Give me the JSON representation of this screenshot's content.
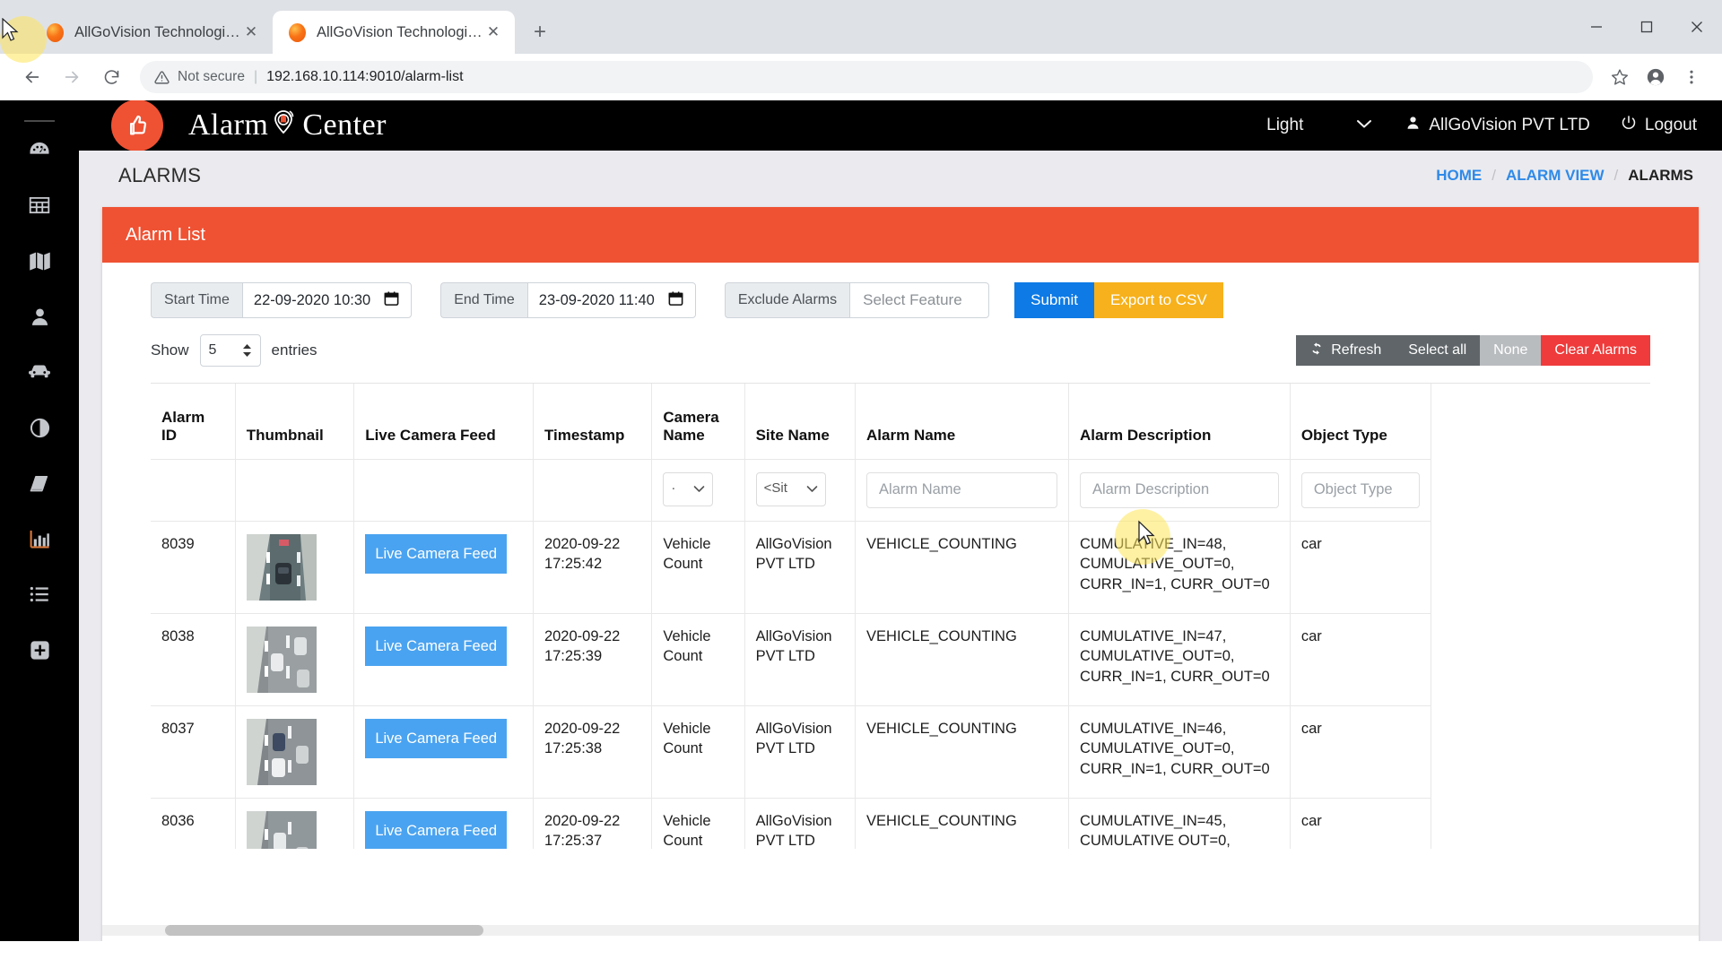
{
  "browser": {
    "tabs": [
      {
        "title": "AllGoVision Technologies",
        "active": false
      },
      {
        "title": "AllGoVision Technologies",
        "active": true
      }
    ],
    "newtab_label": "+",
    "close_label": "✕",
    "window_controls": {
      "minimize": "–",
      "maximize": "❐",
      "close": "✕"
    },
    "address": {
      "security_label": "Not secure",
      "separator": "|",
      "url": "192.168.10.114:9010/alarm-list"
    }
  },
  "sidebar": {
    "items": [
      {
        "icon": "dashboard-gauge-icon",
        "label": "Dashboard"
      },
      {
        "icon": "table-grid-icon",
        "label": "Table"
      },
      {
        "icon": "map-icon",
        "label": "Map"
      },
      {
        "icon": "person-icon",
        "label": "People"
      },
      {
        "icon": "car-icon",
        "label": "Vehicles"
      },
      {
        "icon": "contrast-circle-icon",
        "label": "Contrast"
      },
      {
        "icon": "book-icon",
        "label": "Reports"
      },
      {
        "icon": "bar-chart-icon",
        "label": "Analytics"
      },
      {
        "icon": "list-icon",
        "label": "Alarm List"
      },
      {
        "icon": "plus-square-icon",
        "label": "Add"
      }
    ]
  },
  "appheader": {
    "logo_icon": "thumbs-up-icon",
    "brand_first": "Alarm",
    "brand_icon": "alarm-pin-icon",
    "brand_second": "Center",
    "theme": {
      "value": "Light",
      "chevron": "⌄"
    },
    "user": {
      "icon": "user-icon",
      "name": "AllGoVision PVT LTD"
    },
    "logout": {
      "icon": "power-icon",
      "label": "Logout"
    }
  },
  "page": {
    "title": "ALARMS",
    "breadcrumb": [
      {
        "label": "HOME",
        "link": true
      },
      {
        "label": "ALARM VIEW",
        "link": true
      },
      {
        "label": "ALARMS",
        "link": false
      }
    ],
    "breadcrumb_separator": "/"
  },
  "panel": {
    "heading": "Alarm List",
    "accent_color": "#ef5233"
  },
  "filters": {
    "start_time": {
      "label": "Start Time",
      "value": "22-09-2020 10:30",
      "icon": "calendar-icon"
    },
    "end_time": {
      "label": "End Time",
      "value": "23-09-2020 11:40",
      "icon": "calendar-icon"
    },
    "exclude_alarms": {
      "label": "Exclude Alarms",
      "placeholder": "Select Feature",
      "value": ""
    },
    "submit_label": "Submit",
    "export_label": "Export to CSV",
    "submit_color": "#0d7ae5",
    "export_color": "#f6b11c"
  },
  "toolbar": {
    "show_label": "Show",
    "entries_value": "5",
    "entries_label": "entries",
    "refresh_label": "Refresh",
    "refresh_icon": "refresh-icon",
    "select_all_label": "Select all",
    "none_label": "None",
    "clear_alarms_label": "Clear Alarms",
    "clear_color": "#ef3b3b"
  },
  "table": {
    "columns": [
      "Alarm ID",
      "Thumbnail",
      "Live Camera Feed",
      "Timestamp",
      "Camera Name",
      "Site Name",
      "Alarm Name",
      "Alarm Description",
      "Object Type"
    ],
    "column_filters": {
      "camera_name": "·",
      "site_name": "<Sit",
      "alarm_name_placeholder": "Alarm Name",
      "alarm_description_placeholder": "Alarm Description",
      "object_type_placeholder": "Object Type"
    },
    "feed_button_label": "Live Camera Feed",
    "rows": [
      {
        "alarm_id": "8039",
        "thumbnail": "traffic-camera-thumbnail",
        "timestamp_date": "2020-09-22",
        "timestamp_time": "17:25:42",
        "camera_name": "Vehicle Count",
        "site_name": "AllGoVision PVT LTD",
        "alarm_name": "VEHICLE_COUNTING",
        "alarm_description": "CUMULATIVE_IN=48, CUMULATIVE_OUT=0, CURR_IN=1, CURR_OUT=0",
        "object_type": "car"
      },
      {
        "alarm_id": "8038",
        "thumbnail": "traffic-camera-thumbnail",
        "timestamp_date": "2020-09-22",
        "timestamp_time": "17:25:39",
        "camera_name": "Vehicle Count",
        "site_name": "AllGoVision PVT LTD",
        "alarm_name": "VEHICLE_COUNTING",
        "alarm_description": "CUMULATIVE_IN=47, CUMULATIVE_OUT=0, CURR_IN=1, CURR_OUT=0",
        "object_type": "car"
      },
      {
        "alarm_id": "8037",
        "thumbnail": "traffic-camera-thumbnail",
        "timestamp_date": "2020-09-22",
        "timestamp_time": "17:25:38",
        "camera_name": "Vehicle Count",
        "site_name": "AllGoVision PVT LTD",
        "alarm_name": "VEHICLE_COUNTING",
        "alarm_description": "CUMULATIVE_IN=46, CUMULATIVE_OUT=0, CURR_IN=1, CURR_OUT=0",
        "object_type": "car"
      },
      {
        "alarm_id": "8036",
        "thumbnail": "traffic-camera-thumbnail",
        "timestamp_date": "2020-09-22",
        "timestamp_time": "17:25:37",
        "camera_name": "Vehicle Count",
        "site_name": "AllGoVision PVT LTD",
        "alarm_name": "VEHICLE_COUNTING",
        "alarm_description": "CUMULATIVE_IN=45, CUMULATIVE OUT=0,",
        "object_type": "car"
      }
    ]
  }
}
